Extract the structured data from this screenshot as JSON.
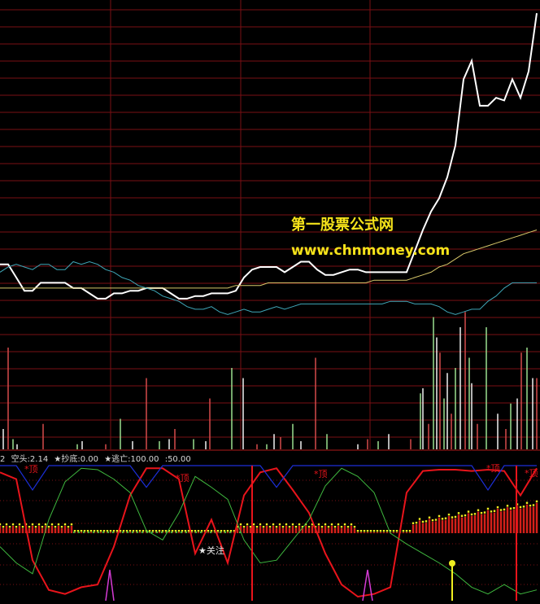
{
  "watermark": {
    "line1": "第一股票公式网",
    "line2": "www.chnmoney.com"
  },
  "indicator_header": {
    "prefix": "2",
    "kongtou": "空头:2.14",
    "chaodi": "★抄底:0.00",
    "taowang": "★逃亡:100.00",
    "level": ":50.00"
  },
  "annotations": {
    "top": "*顶",
    "attention": "★关注"
  },
  "colors": {
    "background": "#000000",
    "grid": "#7a0f14",
    "price": "#ffffff",
    "avg_yellow": "#d8c86a",
    "avg_cyan": "#3fa7b8",
    "red_line": "#e8141b",
    "green_line": "#3fb83f",
    "blue_line": "#1c2fd8",
    "magenta": "#d43ad4",
    "yellow": "#f0ee20",
    "watermark": "#f5e31a"
  },
  "chart_data": [
    {
      "type": "line",
      "panel": "price",
      "x": [
        0,
        10,
        20,
        30,
        40,
        50,
        60,
        70,
        80,
        90,
        100,
        110,
        120,
        130,
        140,
        150,
        160,
        170,
        180,
        190,
        200,
        210,
        220,
        230,
        240,
        250,
        260,
        270,
        280,
        290,
        300,
        310,
        320,
        330,
        340,
        350,
        360,
        370,
        380,
        390,
        400,
        410,
        420,
        430,
        440,
        450,
        460,
        470,
        480,
        490,
        500,
        510,
        520,
        530,
        540,
        550,
        560,
        570,
        580,
        590,
        600,
        610,
        620,
        630,
        640,
        650,
        660
      ],
      "series": [
        {
          "values": [
            5.05,
            5.05,
            5.0,
            4.95,
            4.95,
            4.98,
            4.98,
            4.98,
            4.98,
            4.96,
            4.96,
            4.94,
            4.92,
            4.92,
            4.94,
            4.94,
            4.95,
            4.95,
            4.96,
            4.96,
            4.96,
            4.94,
            4.92,
            4.92,
            4.93,
            4.93,
            4.94,
            4.94,
            4.94,
            4.95,
            5.0,
            5.03,
            5.04,
            5.04,
            5.04,
            5.02,
            5.04,
            5.06,
            5.06,
            5.03,
            5.01,
            5.01,
            5.02,
            5.03,
            5.03,
            5.02,
            5.02,
            5.02,
            5.02,
            5.02,
            5.02,
            5.1,
            5.18,
            5.25,
            5.3,
            5.38,
            5.5,
            5.75,
            5.82,
            5.65,
            5.65,
            5.68,
            5.67,
            5.75,
            5.68,
            5.78,
            6.0
          ]
        },
        {
          "values": [
            4.96,
            4.96,
            4.96,
            4.96,
            4.96,
            4.96,
            4.96,
            4.96,
            4.96,
            4.96,
            4.96,
            4.96,
            4.96,
            4.96,
            4.96,
            4.96,
            4.96,
            4.96,
            4.96,
            4.96,
            4.96,
            4.96,
            4.96,
            4.96,
            4.96,
            4.96,
            4.96,
            4.96,
            4.96,
            4.97,
            4.97,
            4.97,
            4.97,
            4.98,
            4.98,
            4.98,
            4.98,
            4.98,
            4.98,
            4.98,
            4.98,
            4.98,
            4.98,
            4.98,
            4.98,
            4.98,
            4.99,
            4.99,
            4.99,
            4.99,
            4.99,
            5.0,
            5.01,
            5.02,
            5.04,
            5.05,
            5.07,
            5.09,
            5.1,
            5.11,
            5.12,
            5.13,
            5.14,
            5.15,
            5.16,
            5.17,
            5.18
          ]
        },
        {
          "values": [
            5.02,
            5.04,
            5.05,
            5.04,
            5.03,
            5.05,
            5.05,
            5.03,
            5.03,
            5.06,
            5.05,
            5.06,
            5.05,
            5.03,
            5.02,
            5.0,
            4.99,
            4.97,
            4.96,
            4.95,
            4.93,
            4.92,
            4.91,
            4.89,
            4.88,
            4.88,
            4.89,
            4.87,
            4.86,
            4.87,
            4.88,
            4.87,
            4.87,
            4.88,
            4.89,
            4.88,
            4.89,
            4.9,
            4.9,
            4.9,
            4.9,
            4.9,
            4.9,
            4.9,
            4.9,
            4.9,
            4.9,
            4.9,
            4.91,
            4.91,
            4.91,
            4.9,
            4.9,
            4.9,
            4.89,
            4.87,
            4.86,
            4.87,
            4.88,
            4.88,
            4.91,
            4.93,
            4.96,
            4.98,
            4.98,
            4.98,
            4.98
          ]
        }
      ]
    },
    {
      "type": "bar",
      "panel": "volume",
      "x": [
        4,
        10,
        16,
        21,
        53,
        95,
        101,
        130,
        148,
        163,
        180,
        196,
        208,
        215,
        238,
        253,
        258,
        285,
        299,
        316,
        328,
        337,
        345,
        360,
        370,
        388,
        402,
        440,
        452,
        465,
        478,
        505,
        517,
        520,
        527,
        533,
        537,
        541,
        546,
        550,
        555,
        560,
        566,
        572,
        577,
        580,
        587,
        598,
        612,
        622,
        628,
        636,
        641,
        648,
        655,
        660
      ],
      "values": [
        20,
        100,
        10,
        5,
        25,
        5,
        8,
        5,
        30,
        8,
        70,
        8,
        10,
        20,
        10,
        8,
        50,
        80,
        70,
        5,
        5,
        15,
        12,
        25,
        8,
        90,
        15,
        5,
        10,
        8,
        15,
        10,
        55,
        60,
        25,
        130,
        110,
        95,
        50,
        75,
        35,
        80,
        120,
        135,
        90,
        65,
        25,
        120,
        35,
        20,
        45,
        50,
        95,
        100,
        70,
        70
      ]
    },
    {
      "type": "line",
      "panel": "indicator",
      "x": [
        0,
        20,
        40,
        60,
        80,
        100,
        120,
        140,
        160,
        180,
        200,
        220,
        240,
        260,
        280,
        300,
        320,
        340,
        360,
        380,
        400,
        420,
        440,
        460,
        480,
        500,
        520,
        540,
        560,
        580,
        600,
        620,
        640,
        660
      ],
      "series": [
        {
          "values": [
            95,
            90,
            30,
            8,
            5,
            10,
            12,
            40,
            78,
            98,
            98,
            90,
            35,
            60,
            28,
            78,
            95,
            98,
            82,
            65,
            35,
            12,
            3,
            5,
            10,
            80,
            96,
            97,
            97,
            96,
            97,
            96,
            78,
            98
          ]
        },
        {
          "values": [
            40,
            28,
            20,
            60,
            88,
            98,
            97,
            90,
            80,
            52,
            45,
            65,
            92,
            84,
            75,
            45,
            28,
            30,
            45,
            60,
            85,
            98,
            92,
            80,
            50,
            42,
            35,
            28,
            20,
            10,
            5,
            12,
            5,
            8
          ]
        },
        {
          "values": [
            100,
            100,
            82,
            100,
            100,
            100,
            100,
            100,
            100,
            84,
            100,
            100,
            100,
            100,
            100,
            100,
            100,
            84,
            100,
            100,
            100,
            100,
            100,
            100,
            100,
            100,
            100,
            100,
            100,
            100,
            82,
            100,
            100,
            100
          ]
        }
      ]
    }
  ]
}
